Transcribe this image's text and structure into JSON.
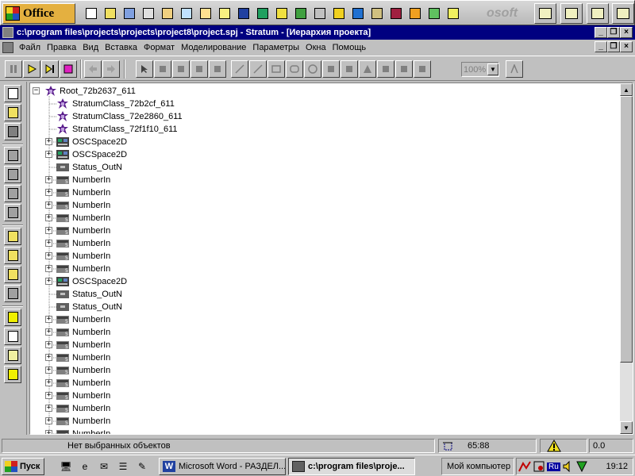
{
  "office_bar": {
    "logo_label": "Office",
    "brand_text": "osoft",
    "buttons": [
      "new-document",
      "open-document",
      "outlook",
      "calendar",
      "tasks",
      "contacts",
      "journal",
      "notes",
      "word",
      "excel",
      "answer-wizard",
      "scheduler",
      "binder",
      "find",
      "internet-explorer",
      "bookshelf",
      "access",
      "paint",
      "network",
      "help"
    ]
  },
  "window": {
    "title": "c:\\program files\\projects\\projects\\project8\\project.spj - Stratum - [Иерархия проекта]",
    "minimize": "_",
    "restore": "❐",
    "close": "×"
  },
  "menu": [
    "Файл",
    "Правка",
    "Вид",
    "Вставка",
    "Формат",
    "Моделирование",
    "Параметры",
    "Окна",
    "Помощь"
  ],
  "toolbar": {
    "zoom": "100%"
  },
  "tree": {
    "root": "Root_72b2637_611",
    "classes": [
      "StratumClass_72b2cf_611",
      "StratumClass_72e2860_611",
      "StratumClass_72f1f10_611"
    ],
    "items": [
      {
        "label": "OSCSpace2D",
        "expandable": true,
        "icon": "osc-space-icon"
      },
      {
        "label": "OSCSpace2D",
        "expandable": true,
        "icon": "osc-space-icon"
      },
      {
        "label": "Status_OutN",
        "expandable": false,
        "icon": "status-out-icon"
      },
      {
        "label": "NumberIn",
        "expandable": true,
        "icon": "number-in-icon"
      },
      {
        "label": "NumberIn",
        "expandable": true,
        "icon": "number-in-icon"
      },
      {
        "label": "NumberIn",
        "expandable": true,
        "icon": "number-in-icon"
      },
      {
        "label": "NumberIn",
        "expandable": true,
        "icon": "number-in-icon"
      },
      {
        "label": "NumberIn",
        "expandable": true,
        "icon": "number-in-icon"
      },
      {
        "label": "NumberIn",
        "expandable": true,
        "icon": "number-in-icon"
      },
      {
        "label": "NumberIn",
        "expandable": true,
        "icon": "number-in-icon"
      },
      {
        "label": "NumberIn",
        "expandable": true,
        "icon": "number-in-icon"
      },
      {
        "label": "OSCSpace2D",
        "expandable": true,
        "icon": "osc-space-icon"
      },
      {
        "label": "Status_OutN",
        "expandable": false,
        "icon": "status-out-icon"
      },
      {
        "label": "Status_OutN",
        "expandable": false,
        "icon": "status-out-icon"
      },
      {
        "label": "NumberIn",
        "expandable": true,
        "icon": "number-in-icon"
      },
      {
        "label": "NumberIn",
        "expandable": true,
        "icon": "number-in-icon"
      },
      {
        "label": "NumberIn",
        "expandable": true,
        "icon": "number-in-icon"
      },
      {
        "label": "NumberIn",
        "expandable": true,
        "icon": "number-in-icon"
      },
      {
        "label": "NumberIn",
        "expandable": true,
        "icon": "number-in-icon"
      },
      {
        "label": "NumberIn",
        "expandable": true,
        "icon": "number-in-icon"
      },
      {
        "label": "NumberIn",
        "expandable": true,
        "icon": "number-in-icon"
      },
      {
        "label": "NumberIn",
        "expandable": true,
        "icon": "number-in-icon"
      },
      {
        "label": "NumberIn",
        "expandable": true,
        "icon": "number-in-icon"
      },
      {
        "label": "NumberIn",
        "expandable": true,
        "icon": "number-in-icon"
      }
    ]
  },
  "status_bar": {
    "message": "Нет выбранных объектов",
    "coords": "65:88",
    "value": "0.0"
  },
  "taskbar": {
    "start_label": "Пуск",
    "tasks": [
      {
        "label": "Microsoft Word - РАЗДЕЛ...",
        "active": false
      },
      {
        "label": "c:\\program files\\proje...",
        "active": true
      }
    ],
    "my_computer": "Мой компьютер",
    "lang": "Ru",
    "clock": "19:12"
  },
  "colors": {
    "face": "#c0c0c0",
    "title_active": "#000080",
    "tree_bg": "#ffffff",
    "node_icon": "#5a1e8c"
  }
}
